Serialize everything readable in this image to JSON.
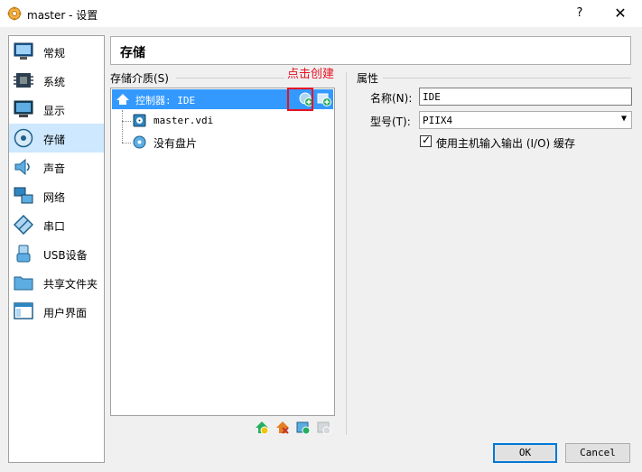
{
  "window": {
    "title": "master - 设置",
    "help_label": "?",
    "close_label": "✕"
  },
  "sidebar": {
    "items": [
      {
        "label": "常规",
        "icon": "monitor-icon"
      },
      {
        "label": "系统",
        "icon": "chip-icon"
      },
      {
        "label": "显示",
        "icon": "display-icon"
      },
      {
        "label": "存储",
        "icon": "disk-icon",
        "selected": true
      },
      {
        "label": "声音",
        "icon": "speaker-icon"
      },
      {
        "label": "网络",
        "icon": "network-icon"
      },
      {
        "label": "串口",
        "icon": "serial-port-icon"
      },
      {
        "label": "USB设备",
        "icon": "usb-icon"
      },
      {
        "label": "共享文件夹",
        "icon": "folder-icon"
      },
      {
        "label": "用户界面",
        "icon": "ui-window-icon"
      }
    ]
  },
  "page": {
    "title": "存储"
  },
  "storage": {
    "group_label": "存储介质(S)",
    "controller": {
      "label": "控制器: IDE"
    },
    "attachments": [
      {
        "label": "master.vdi",
        "icon": "hard-disk-icon"
      },
      {
        "label": "没有盘片",
        "icon": "optical-disc-icon"
      }
    ],
    "annotation": "点击创建"
  },
  "attributes": {
    "group_label": "属性",
    "name_label": "名称(N):",
    "name_value": "IDE",
    "type_label": "型号(T):",
    "type_value": "PIIX4",
    "host_io_label": "使用主机输入输出 (I/O) 缓存",
    "host_io_checked": true
  },
  "buttons": {
    "ok": "OK",
    "cancel": "Cancel"
  },
  "colors": {
    "selection": "#3399ff",
    "sidebar_selected": "#cde8ff",
    "annotation": "#e81123",
    "ok_border": "#0078d7"
  }
}
